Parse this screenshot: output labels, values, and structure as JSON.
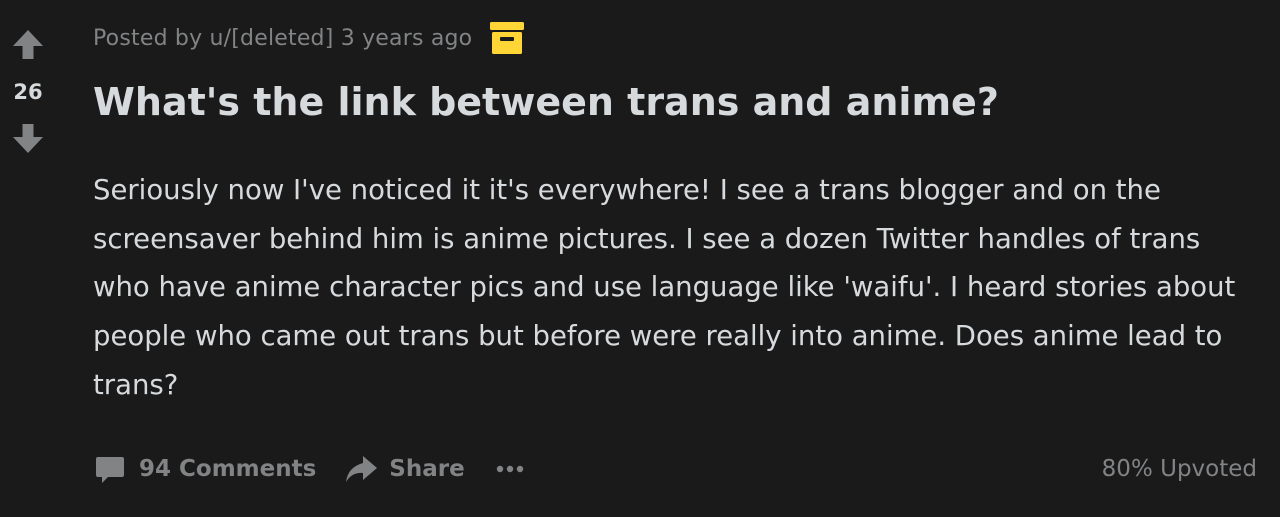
{
  "post": {
    "score": "26",
    "meta": {
      "posted_by": "Posted by u/[deleted] 3 years ago",
      "archive_icon": "archive-icon"
    },
    "title": "What's the link between trans and anime?",
    "body": "Seriously now I've noticed it it's everywhere! I see a trans blogger and on the screensaver behind him is anime pictures. I see a dozen Twitter handles of trans who have anime character pics and use language like 'waifu'. I heard stories about people who came out trans but before were really into anime. Does anime lead to trans?",
    "actions": {
      "comments_label": "94 Comments",
      "share_label": "Share",
      "more_icon": "more-dots-icon"
    },
    "upvote_ratio": "80% Upvoted"
  },
  "colors": {
    "background": "#1a1a1b",
    "text": "#d7dadc",
    "muted": "#818384",
    "archive_yellow": "#ffd635"
  }
}
